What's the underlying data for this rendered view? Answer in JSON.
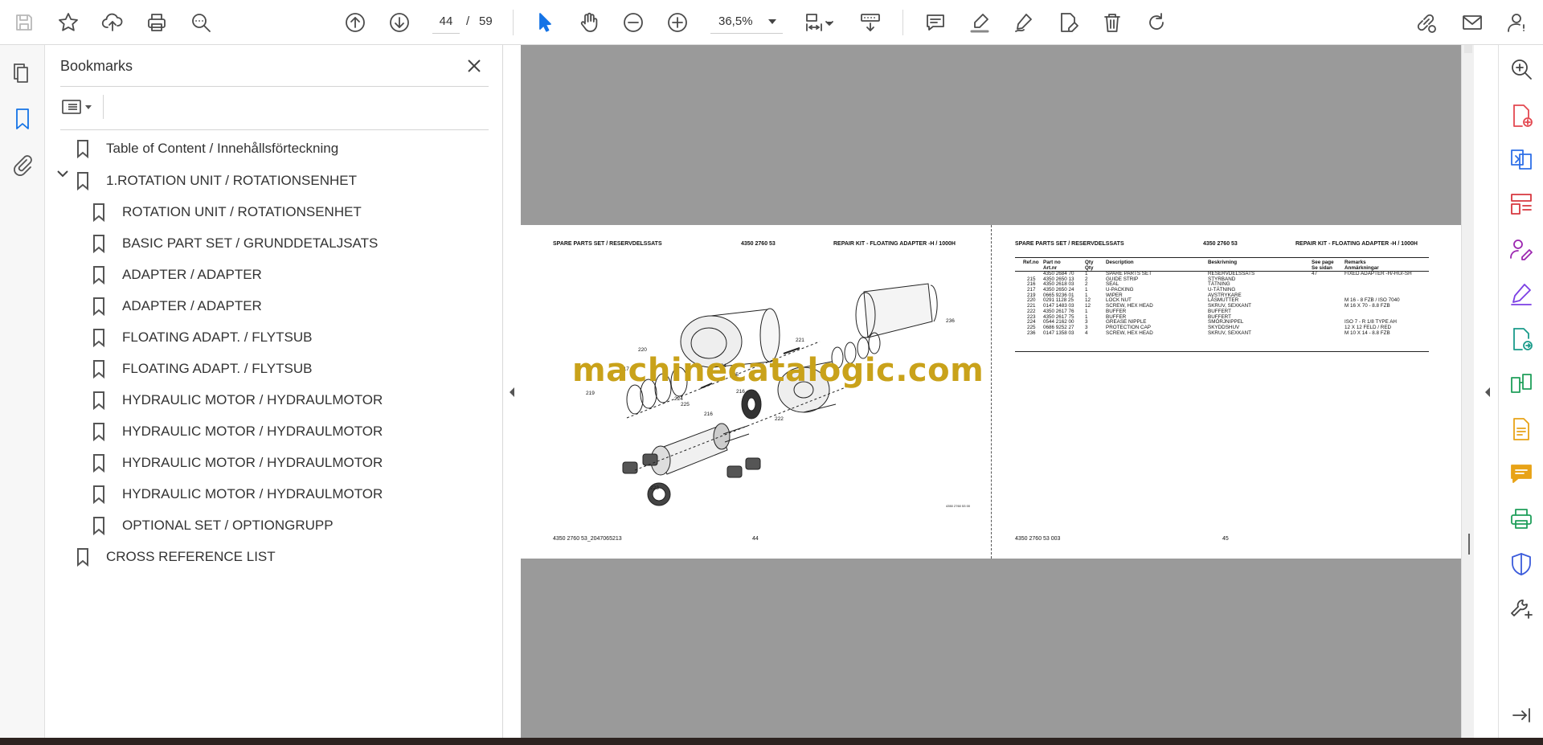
{
  "toolbar": {
    "page_current": "44",
    "page_separator": "/",
    "page_total": "59",
    "zoom": "36,5%"
  },
  "bookmarks": {
    "title": "Bookmarks",
    "items": [
      {
        "label": "Table of Content / Innehållsförteckning"
      },
      {
        "label": "1.ROTATION UNIT / ROTATIONSENHET"
      },
      {
        "label": "ROTATION UNIT / ROTATIONSENHET"
      },
      {
        "label": "BASIC PART SET / GRUNDDETALJSATS"
      },
      {
        "label": "ADAPTER / ADAPTER"
      },
      {
        "label": "ADAPTER / ADAPTER"
      },
      {
        "label": "FLOATING ADAPT. / FLYTSUB"
      },
      {
        "label": "FLOATING ADAPT. / FLYTSUB"
      },
      {
        "label": "HYDRAULIC MOTOR / HYDRAULMOTOR"
      },
      {
        "label": "HYDRAULIC MOTOR / HYDRAULMOTOR"
      },
      {
        "label": "HYDRAULIC MOTOR / HYDRAULMOTOR"
      },
      {
        "label": "HYDRAULIC MOTOR / HYDRAULMOTOR"
      },
      {
        "label": "OPTIONAL SET / OPTIONGRUPP"
      },
      {
        "label": "CROSS REFERENCE LIST"
      }
    ]
  },
  "doc": {
    "left": {
      "header_left": "SPARE PARTS SET / RESERVDELSSATS",
      "header_mid": "4350 2760 53",
      "header_right": "REPAIR KIT - FLOATING ADAPTER -H / 1000H",
      "footer_left": "4350 2760 53_2047065213",
      "footer_page": "44",
      "drawing_ref": "4350 2760 53 00",
      "callouts": [
        "220",
        "221",
        "236",
        "217",
        "224",
        "225",
        "219",
        "224",
        "225",
        "216",
        "216",
        "222",
        "223"
      ]
    },
    "right": {
      "header_left": "SPARE PARTS SET / RESERVDELSSATS",
      "header_mid": "4350 2760 53",
      "header_right": "REPAIR KIT - FLOATING ADAPTER -H / 1000H",
      "footer_left": "4350 2760 53 003",
      "footer_page": "45"
    },
    "table": {
      "headers": [
        "Ref.no",
        "Part no\nArt.nr",
        "Qty\nQty",
        "Description",
        "Beskrivning",
        "See page\nSe sidan",
        "Remarks\nAnmärkningar"
      ],
      "rows": [
        [
          "",
          "4350 2684 70",
          "1",
          "SPARE PARTS SET",
          "RESERVDELSSATS",
          "47",
          "FIXED ADAPTER -H/-HU/-SH"
        ],
        [
          "215",
          "4350 2650 13",
          "2",
          "GUIDE STRIP",
          "STYRBAND",
          "",
          ""
        ],
        [
          "216",
          "4350 2618 03",
          "2",
          "SEAL",
          "TÄTNING",
          "",
          ""
        ],
        [
          "217",
          "4350 2650 24",
          "1",
          "U-PACKING",
          "U-TÄTNING",
          "",
          ""
        ],
        [
          "219",
          "0665 9236 01",
          "1",
          "WIPER",
          "AVSTRYKARE",
          "",
          ""
        ],
        [
          "220",
          "0291 1128 25",
          "12",
          "LOCK NUT",
          "LÅSMUTTER",
          "",
          "M 16 - 8 FZB / ISO 7040"
        ],
        [
          "221",
          "0147 1483 03",
          "12",
          "SCREW, HEX HEAD",
          "SKRUV, SEXKANT",
          "",
          "M 16 X 70 - 8.8 FZB"
        ],
        [
          "222",
          "4350 2617 76",
          "1",
          "BUFFER",
          "BUFFERT",
          "",
          ""
        ],
        [
          "223",
          "4350 2617 75",
          "1",
          "BUFFER",
          "BUFFERT",
          "",
          ""
        ],
        [
          "224",
          "0544 2162 00",
          "3",
          "GREASE NIPPLE",
          "SMÖRJNIPPEL",
          "",
          "ISO 7 - R 1/8 TYPE AH"
        ],
        [
          "225",
          "0686 9252 27",
          "3",
          "PROTECTION CAP",
          "SKYDDSHUV",
          "",
          "12 X 12 FELD / RED"
        ],
        [
          "236",
          "0147 1358 03",
          "4",
          "SCREW, HEX HEAD",
          "SKRUV, SEXKANT",
          "",
          "M 10 X 14 - 8.8 FZB"
        ]
      ]
    },
    "watermark": "machinecatalogic.com"
  },
  "colors": {
    "accent": "#1473e6",
    "viewer_bg": "#9a9a9a",
    "watermark": "#c9a21a",
    "right_rail_icons": [
      "#e34850",
      "#2d6fe8",
      "#d7373f",
      "#9c27b0",
      "#7b3fe4",
      "#1a9b8a",
      "#1f9e5a",
      "#e8a317",
      "#e8a317",
      "#1f9e5a",
      "#3b5bdb",
      "#444444"
    ]
  }
}
